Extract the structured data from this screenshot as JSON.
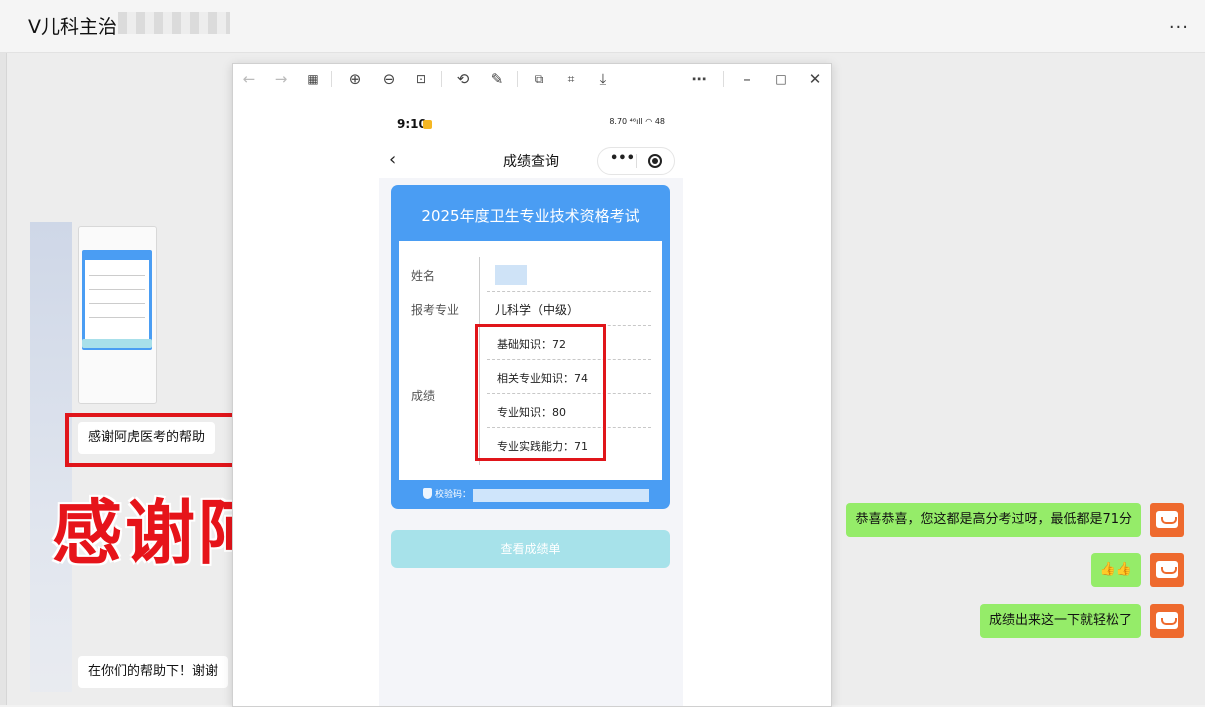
{
  "chat": {
    "title": "V儿科主治",
    "more": "..."
  },
  "left_messages": [
    {
      "text": "感谢阿虎医考的帮助"
    },
    {
      "text": "在你们的帮助下！谢谢"
    }
  ],
  "overlay_text": "感谢阿虎",
  "right_messages": [
    {
      "text": "恭喜恭喜，您这都是高分考过呀，最低都是71分"
    },
    {
      "text": "👍👍"
    },
    {
      "text": "成绩出来这一下就轻松了"
    }
  ],
  "viewer": {
    "toolbar_icons": [
      "arrow-left-icon",
      "arrow-right-icon",
      "grid-icon",
      "zoom-in-icon",
      "zoom-out-icon",
      "fit-icon",
      "rotate-icon",
      "edit-icon",
      "copy-icon",
      "scan-icon",
      "download-icon",
      "more-icon",
      "minimize-icon",
      "maximize-icon",
      "close-icon"
    ]
  },
  "phone": {
    "status_time": "9:10",
    "status_right": "8.70 ⁴⁶ıll ◠ 48",
    "nav_back": "‹",
    "nav_title": "成绩查询",
    "capsule_dots": "•••",
    "card_title": "2025年度卫生专业技术资格考试",
    "rows": {
      "name_label": "姓名",
      "major_label": "报考专业",
      "major_value": "儿科学（中级）",
      "score_label": "成绩"
    },
    "scores": [
      {
        "text": "基础知识：72"
      },
      {
        "text": "相关专业知识：74"
      },
      {
        "text": "专业知识：80"
      },
      {
        "text": "专业实践能力：71"
      }
    ],
    "verify_label": "校验码：",
    "cta_label": "查看成绩单"
  },
  "colors": {
    "accent_blue": "#4a9df3",
    "highlight_red": "#e0151a",
    "bubble_green": "#95ec69",
    "cta_cyan": "#a7e2ea"
  }
}
